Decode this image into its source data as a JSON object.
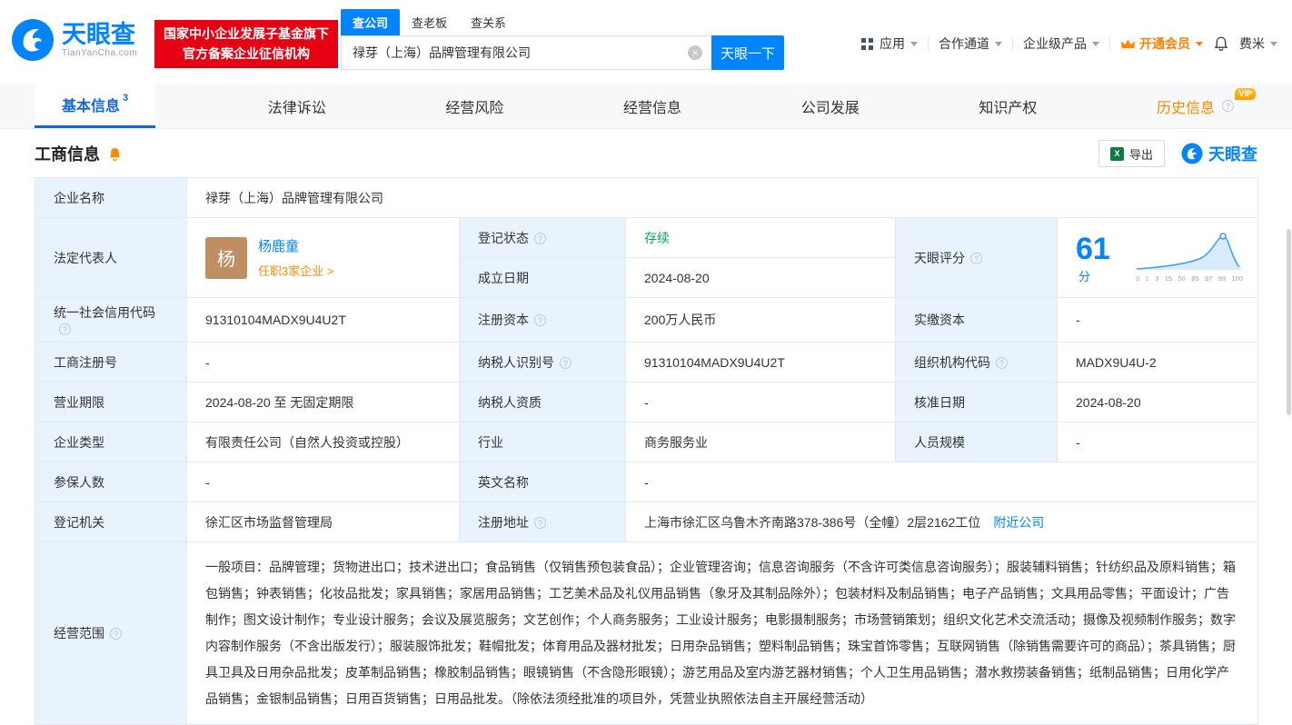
{
  "brand": {
    "name": "天眼查",
    "domain": "TianYanCha.com",
    "blue": "#0084ff",
    "orange": "#ff8000"
  },
  "header": {
    "gov_badge": {
      "line1": "国家中小企业发展子基金旗下",
      "line2": "官方备案企业征信机构"
    },
    "search_tabs": [
      {
        "label": "查公司"
      },
      {
        "label": "查老板"
      },
      {
        "label": "查关系"
      }
    ],
    "search": {
      "value": "禄芽（上海）品牌管理有限公司",
      "button": "天眼一下"
    },
    "nav": {
      "apps": "应用",
      "cooperation": "合作通道",
      "enterprise": "企业级产品",
      "vip": "开通会员",
      "user": "费米"
    }
  },
  "nav_tabs": [
    {
      "label": "基本信息",
      "badge": "3"
    },
    {
      "label": "法律诉讼"
    },
    {
      "label": "经营风险"
    },
    {
      "label": "经营信息"
    },
    {
      "label": "公司发展"
    },
    {
      "label": "知识产权"
    },
    {
      "label": "历史信息",
      "vip": "VIP"
    }
  ],
  "section": {
    "title": "工商信息",
    "export": "导出",
    "logo_text": "天眼查"
  },
  "info": {
    "company_name": {
      "label": "企业名称",
      "value": "禄芽（上海）品牌管理有限公司"
    },
    "legal_rep": {
      "label": "法定代表人",
      "avatar": "杨",
      "name": "杨鹿童",
      "note": "任职3家企业 >"
    },
    "reg_status": {
      "label": "登记状态",
      "value": "存续"
    },
    "est_date": {
      "label": "成立日期",
      "value": "2024-08-20"
    },
    "score": {
      "label": "天眼评分",
      "value": "61",
      "unit": "分",
      "axis": [
        "0",
        "1",
        "3",
        "15",
        "50",
        "85",
        "97",
        "99",
        "100"
      ]
    },
    "credit_code": {
      "label": "统一社会信用代码",
      "value": "91310104MADX9U4U2T"
    },
    "reg_capital": {
      "label": "注册资本",
      "value": "200万人民币"
    },
    "paid_capital": {
      "label": "实缴资本",
      "value": "-"
    },
    "reg_no": {
      "label": "工商注册号",
      "value": "-"
    },
    "taxpayer_no": {
      "label": "纳税人识别号",
      "value": "91310104MADX9U4U2T"
    },
    "org_code": {
      "label": "组织机构代码",
      "value": "MADX9U4U-2"
    },
    "term": {
      "label": "营业期限",
      "value": "2024-08-20 至 无固定期限"
    },
    "taxpayer_quality": {
      "label": "纳税人资质",
      "value": "-"
    },
    "approve_date": {
      "label": "核准日期",
      "value": "2024-08-20"
    },
    "company_type": {
      "label": "企业类型",
      "value": "有限责任公司（自然人投资或控股）"
    },
    "industry": {
      "label": "行业",
      "value": "商务服务业"
    },
    "staff_size": {
      "label": "人员规模",
      "value": "-"
    },
    "insured": {
      "label": "参保人数",
      "value": "-"
    },
    "english_name": {
      "label": "英文名称",
      "value": "-"
    },
    "reg_authority": {
      "label": "登记机关",
      "value": "徐汇区市场监督管理局"
    },
    "address": {
      "label": "注册地址",
      "value": "上海市徐汇区乌鲁木齐南路378-386号（全幢）2层2162工位",
      "link": "附近公司"
    },
    "scope": {
      "label": "经营范围",
      "value": "一般项目：品牌管理；货物进出口；技术进出口；食品销售（仅销售预包装食品）；企业管理咨询；信息咨询服务（不含许可类信息咨询服务）；服装辅料销售；针纺织品及原料销售；箱包销售；钟表销售；化妆品批发；家具销售；家居用品销售；工艺美术品及礼仪用品销售（象牙及其制品除外）；包装材料及制品销售；电子产品销售；文具用品零售；平面设计；广告制作；图文设计制作；专业设计服务；会议及展览服务；文艺创作；个人商务服务；工业设计服务；电影摄制服务；市场营销策划；组织文化艺术交流活动；摄像及视频制作服务；数字内容制作服务（不含出版发行）；服装服饰批发；鞋帽批发；体育用品及器材批发；日用杂品销售；塑料制品销售；珠宝首饰零售；互联网销售（除销售需要许可的商品）；茶具销售；厨具卫具及日用杂品批发；皮革制品销售；橡胶制品销售；眼镜销售（不含隐形眼镜）；游艺用品及室内游艺器材销售；个人卫生用品销售；潜水救捞装备销售；纸制品销售；日用化学产品销售；金银制品销售；日用百货销售；日用品批发。（除依法须经批准的项目外，凭营业执照依法自主开展经营活动）"
    }
  }
}
